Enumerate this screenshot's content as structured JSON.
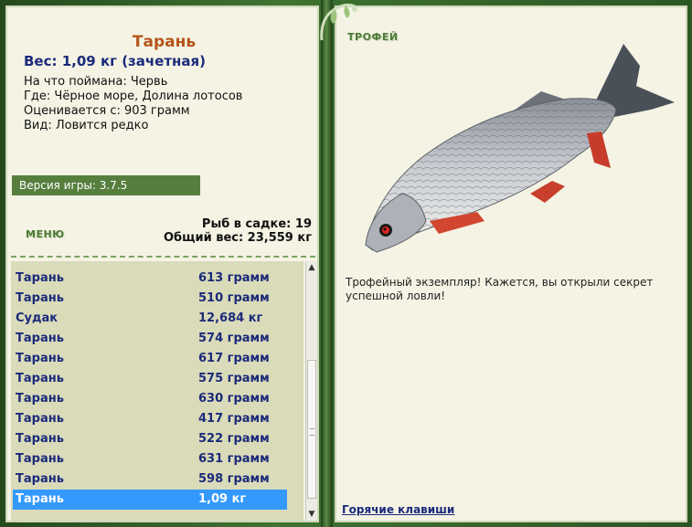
{
  "fish": {
    "name": "Тарань",
    "weight": "Вес: 1,09 кг (зачетная)",
    "bait": "На что поймана: Червь",
    "place": "Где: Чёрное море, Долина лотосов",
    "value": "Оценивается с: 903 грамм",
    "kind": "Вид: Ловится редко"
  },
  "version": "Версия игры: 3.7.5",
  "menu_label": "МЕНЮ",
  "stats": {
    "count": "Рыб в садке: 19",
    "total": "Общий вес: 23,559 кг"
  },
  "catch_list": [
    {
      "name": "Тарань",
      "weight": "613 грамм"
    },
    {
      "name": "Тарань",
      "weight": "510 грамм"
    },
    {
      "name": "Судак",
      "weight": "12,684 кг"
    },
    {
      "name": "Тарань",
      "weight": "574 грамм"
    },
    {
      "name": "Тарань",
      "weight": "617 грамм"
    },
    {
      "name": "Тарань",
      "weight": "575 грамм"
    },
    {
      "name": "Тарань",
      "weight": "630 грамм"
    },
    {
      "name": "Тарань",
      "weight": "417 грамм"
    },
    {
      "name": "Тарань",
      "weight": "522 грамм"
    },
    {
      "name": "Тарань",
      "weight": "631 грамм"
    },
    {
      "name": "Тарань",
      "weight": "598 грамм"
    },
    {
      "name": "Тарань",
      "weight": "1,09 кг"
    }
  ],
  "selected_index": 11,
  "trophy": {
    "title": "ТРОФЕЙ",
    "text": "Трофейный экземпляр! Кажется, вы открыли секрет успешной ловли!"
  },
  "hotkeys_label": "Горячие клавиши",
  "colors": {
    "selection": "#3399ff",
    "link_blue": "#1b2a7a",
    "title_orange": "#b5541a",
    "menu_green": "#4d7a37"
  }
}
